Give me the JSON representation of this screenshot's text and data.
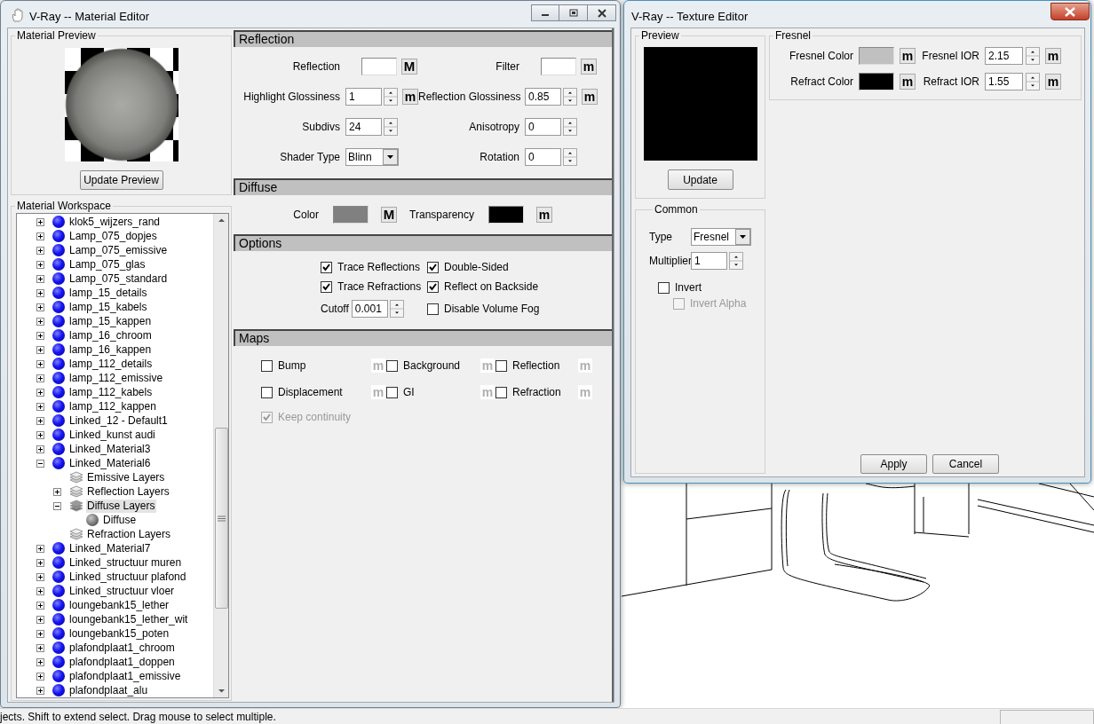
{
  "material_editor": {
    "title": "V-Ray -- Material Editor",
    "preview": {
      "title": "Material Preview",
      "button": "Update Preview"
    },
    "workspace": {
      "title": "Material Workspace",
      "tree": [
        {
          "label": "klok5_wijzers_rand",
          "kind": "material",
          "expanded": false,
          "selected": false
        },
        {
          "label": "Lamp_075_dopjes",
          "kind": "material",
          "expanded": false,
          "selected": false
        },
        {
          "label": "Lamp_075_emissive",
          "kind": "material",
          "expanded": false,
          "selected": false
        },
        {
          "label": "Lamp_075_glas",
          "kind": "material",
          "expanded": false,
          "selected": false
        },
        {
          "label": "Lamp_075_standard",
          "kind": "material",
          "expanded": false,
          "selected": false
        },
        {
          "label": "lamp_15_details",
          "kind": "material",
          "expanded": false,
          "selected": false
        },
        {
          "label": "lamp_15_kabels",
          "kind": "material",
          "expanded": false,
          "selected": false
        },
        {
          "label": "lamp_15_kappen",
          "kind": "material",
          "expanded": false,
          "selected": false
        },
        {
          "label": "lamp_16_chroom",
          "kind": "material",
          "expanded": false,
          "selected": false
        },
        {
          "label": "lamp_16_kappen",
          "kind": "material",
          "expanded": false,
          "selected": false
        },
        {
          "label": "lamp_112_details",
          "kind": "material",
          "expanded": false,
          "selected": false
        },
        {
          "label": "lamp_112_emissive",
          "kind": "material",
          "expanded": false,
          "selected": false
        },
        {
          "label": "lamp_112_kabels",
          "kind": "material",
          "expanded": false,
          "selected": false
        },
        {
          "label": "lamp_112_kappen",
          "kind": "material",
          "expanded": false,
          "selected": false
        },
        {
          "label": "Linked_12 - Default1",
          "kind": "material",
          "expanded": false,
          "selected": false
        },
        {
          "label": "Linked_kunst audi",
          "kind": "material",
          "expanded": false,
          "selected": false
        },
        {
          "label": "Linked_Material3",
          "kind": "material",
          "expanded": false,
          "selected": false
        },
        {
          "label": "Linked_Material6",
          "kind": "material",
          "expanded": true,
          "selected": false,
          "children": [
            {
              "label": "Emissive Layers",
              "kind": "layers",
              "selected": false
            },
            {
              "label": "Reflection Layers",
              "kind": "layers",
              "expanded": false,
              "selected": false
            },
            {
              "label": "Diffuse Layers",
              "kind": "layers",
              "expanded": true,
              "selected": true,
              "children": [
                {
                  "label": "Diffuse",
                  "kind": "map",
                  "selected": false
                }
              ]
            },
            {
              "label": "Refraction Layers",
              "kind": "layers",
              "selected": false
            }
          ]
        },
        {
          "label": "Linked_Material7",
          "kind": "material",
          "expanded": false,
          "selected": false
        },
        {
          "label": "Linked_structuur muren",
          "kind": "material",
          "expanded": false,
          "selected": false
        },
        {
          "label": "Linked_structuur plafond",
          "kind": "material",
          "expanded": false,
          "selected": false
        },
        {
          "label": "Linked_structuur vloer",
          "kind": "material",
          "expanded": false,
          "selected": false
        },
        {
          "label": "loungebank15_lether",
          "kind": "material",
          "expanded": false,
          "selected": false
        },
        {
          "label": "loungebank15_lether_wit",
          "kind": "material",
          "expanded": false,
          "selected": false
        },
        {
          "label": "loungebank15_poten",
          "kind": "material",
          "expanded": false,
          "selected": false
        },
        {
          "label": "plafondplaat1_chroom",
          "kind": "material",
          "expanded": false,
          "selected": false
        },
        {
          "label": "plafondplaat1_doppen",
          "kind": "material",
          "expanded": false,
          "selected": false
        },
        {
          "label": "plafondplaat1_emissive",
          "kind": "material",
          "expanded": false,
          "selected": false
        },
        {
          "label": "plafondplaat_alu",
          "kind": "material",
          "expanded": false,
          "selected": false
        }
      ]
    },
    "sections": [
      {
        "title": "Reflection",
        "kind": "params",
        "fields": [
          {
            "kind": "color",
            "label": "Reflection",
            "color": "#ffffff",
            "map": {
              "label": "M",
              "disabled": false
            }
          },
          {
            "kind": "color",
            "label": "Filter",
            "color": "#ffffff",
            "map": {
              "label": "m",
              "disabled": false
            }
          },
          {
            "kind": "spinner",
            "label": "Highlight Glossiness",
            "value": "1",
            "map": {
              "label": "m",
              "disabled": false
            }
          },
          {
            "kind": "spinner",
            "label": "Reflection Glossiness",
            "value": "0.85",
            "map": {
              "label": "m",
              "disabled": false
            }
          },
          {
            "kind": "spinner",
            "label": "Subdivs",
            "value": "24"
          },
          {
            "kind": "spinner",
            "label": "Anisotropy",
            "value": "0"
          },
          {
            "kind": "dropdown",
            "label": "Shader Type",
            "value": "Blinn"
          },
          {
            "kind": "spinner",
            "label": "Rotation",
            "value": "0"
          }
        ]
      },
      {
        "title": "Diffuse",
        "kind": "swatches",
        "fields": [
          {
            "kind": "color",
            "label": "Color",
            "color": "#808080",
            "map": {
              "label": "M",
              "disabled": false
            }
          },
          {
            "kind": "color",
            "label": "Transparency",
            "color": "#000000",
            "map": {
              "label": "m",
              "disabled": false
            }
          }
        ]
      },
      {
        "title": "Options",
        "kind": "options",
        "fields": [
          {
            "kind": "checkbox",
            "label": "Trace Reflections",
            "checked": true,
            "disabled": false
          },
          {
            "kind": "checkbox",
            "label": "Double-Sided",
            "checked": true,
            "disabled": false
          },
          {
            "kind": "checkbox",
            "label": "Trace Refractions",
            "checked": true,
            "disabled": false
          },
          {
            "kind": "checkbox",
            "label": "Reflect on Backside",
            "checked": true,
            "disabled": false
          },
          {
            "kind": "spinner",
            "label": "Cutoff",
            "value": "0.001"
          },
          {
            "kind": "checkbox",
            "label": "Disable Volume Fog",
            "checked": false,
            "disabled": false
          }
        ]
      },
      {
        "title": "Maps",
        "kind": "maps",
        "fields": [
          {
            "kind": "mapslot",
            "label": "Bump",
            "checked": false,
            "map": {
              "label": "m",
              "disabled": true
            }
          },
          {
            "kind": "mapslot",
            "label": "Background",
            "checked": false,
            "map": {
              "label": "m",
              "disabled": true
            }
          },
          {
            "kind": "mapslot",
            "label": "Reflection",
            "checked": false,
            "map": {
              "label": "m",
              "disabled": true
            }
          },
          {
            "kind": "mapslot",
            "label": "Displacement",
            "checked": false,
            "map": {
              "label": "m",
              "disabled": true
            }
          },
          {
            "kind": "mapslot",
            "label": "GI",
            "checked": false,
            "map": {
              "label": "m",
              "disabled": true
            }
          },
          {
            "kind": "mapslot",
            "label": "Refraction",
            "checked": false,
            "map": {
              "label": "m",
              "disabled": true
            }
          },
          {
            "kind": "checkbox",
            "label": "Keep continuity",
            "checked": true,
            "disabled": true
          }
        ]
      }
    ]
  },
  "texture_editor": {
    "title": "V-Ray -- Texture Editor",
    "preview": {
      "title": "Preview",
      "button": "Update"
    },
    "common": {
      "title": "Common",
      "type": {
        "label": "Type",
        "value": "Fresnel"
      },
      "multiplier": {
        "label": "Multiplier",
        "value": "1"
      },
      "invert": {
        "label": "Invert",
        "checked": false,
        "disabled": false,
        "children": [
          {
            "label": "Invert Alpha",
            "checked": false,
            "disabled": true
          }
        ]
      }
    },
    "fresnel": {
      "title": "Fresnel",
      "fields": [
        {
          "kind": "color",
          "label": "Fresnel Color",
          "color": "#c0c0c0",
          "map": {
            "label": "m",
            "disabled": false
          }
        },
        {
          "kind": "spinner",
          "label": "Fresnel IOR",
          "value": "2.15",
          "map": {
            "label": "m",
            "disabled": false
          }
        },
        {
          "kind": "color",
          "label": "Refract Color",
          "color": "#000000",
          "map": {
            "label": "m",
            "disabled": false
          }
        },
        {
          "kind": "spinner",
          "label": "Refract IOR",
          "value": "1.55",
          "map": {
            "label": "m",
            "disabled": false
          }
        }
      ]
    },
    "buttons": [
      "Apply",
      "Cancel"
    ]
  },
  "status_bar": {
    "text": "jects. Shift to extend select. Drag mouse to select multiple."
  }
}
